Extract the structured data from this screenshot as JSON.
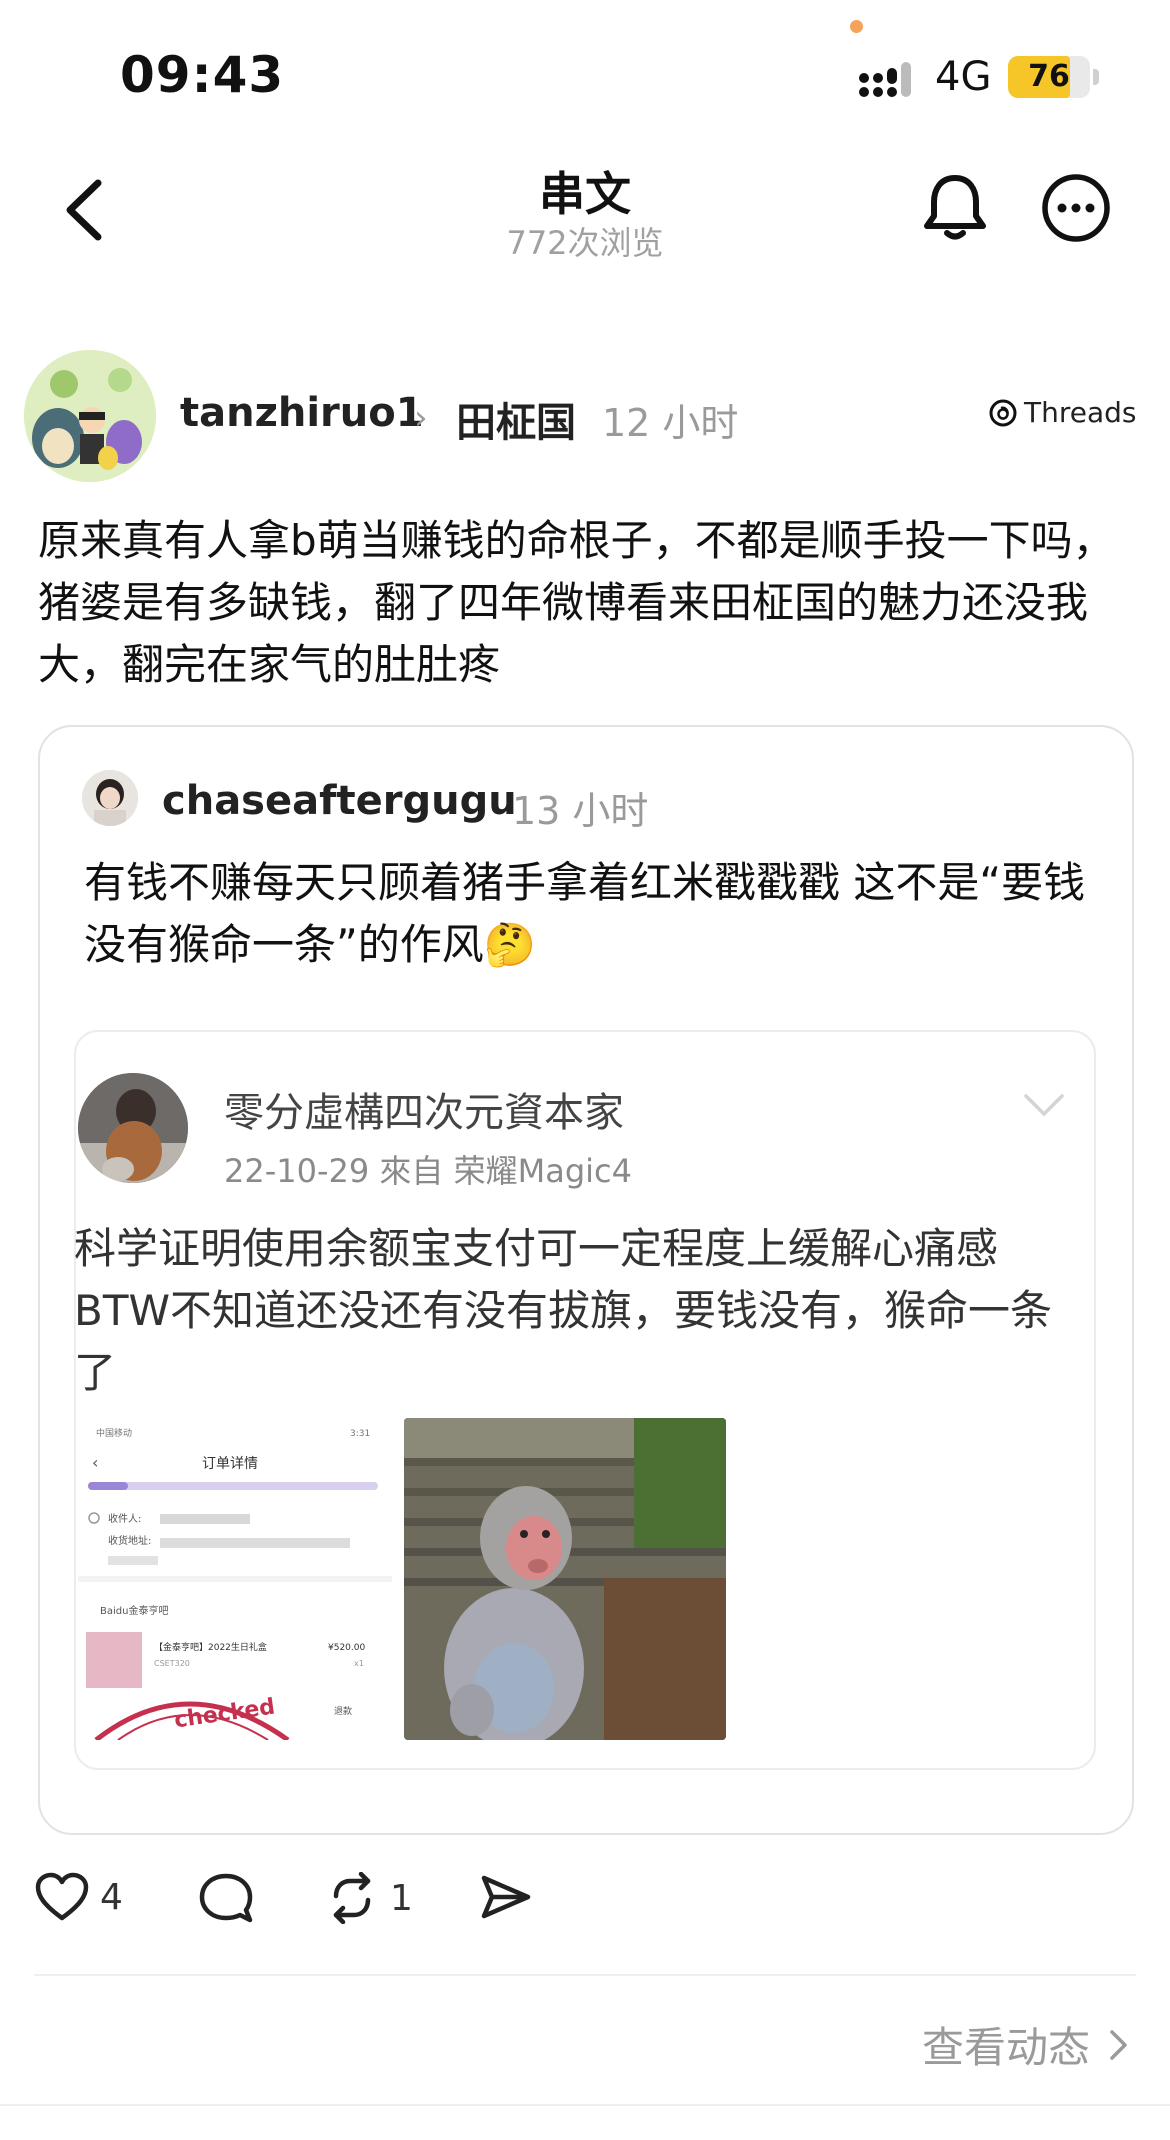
{
  "status_bar": {
    "time": "09:43",
    "network": "4G",
    "battery": "76",
    "battery_level_percent": 76,
    "battery_color": "#f6c629"
  },
  "nav": {
    "title": "串文",
    "subtitle": "772次浏览",
    "icons": [
      "back-arrow-icon",
      "bell-icon",
      "more-icon"
    ]
  },
  "post": {
    "username": "tanzhiruo1",
    "target": "田柾国",
    "time": "12 小时",
    "source_badge": "Threads",
    "text": "原来真有人拿b萌当赚钱的命根子，不都是顺手投一下吗，猪婆是有多缺钱，翻了四年微博看来田柾国的魅力还没我大，翻完在家气的肚肚疼"
  },
  "quote": {
    "username": "chaseaftergugu",
    "time": "13 小时",
    "text": "有钱不赚每天只顾着猪手拿着红米戳戳戳 这不是“要钱没有猴命一条”的作风🤔"
  },
  "weibo": {
    "name": "零分虛構四次元資本家",
    "meta": "22-10-29  來自 荣耀Magic4",
    "text": "科学证明使用余额宝支付可一定程度上缓解心痛感BTW不知道还没还有没有拔旗，要钱没有，猴命一条了",
    "receipt": {
      "carrier": "中国移动",
      "clock": "3:31",
      "title": "订单详情",
      "recipient_label": "收件人:",
      "address_label": "收货地址:",
      "shop": "Baidu金泰亨吧",
      "item": "【金泰亨吧】2022生日礼盒",
      "price": "¥520.00",
      "code": "CSET320",
      "qty": "x1",
      "refund": "退款",
      "stamp": "checked"
    }
  },
  "actions": {
    "likes": "4",
    "reposts": "1"
  },
  "footer": {
    "activity_link": "查看动态"
  }
}
